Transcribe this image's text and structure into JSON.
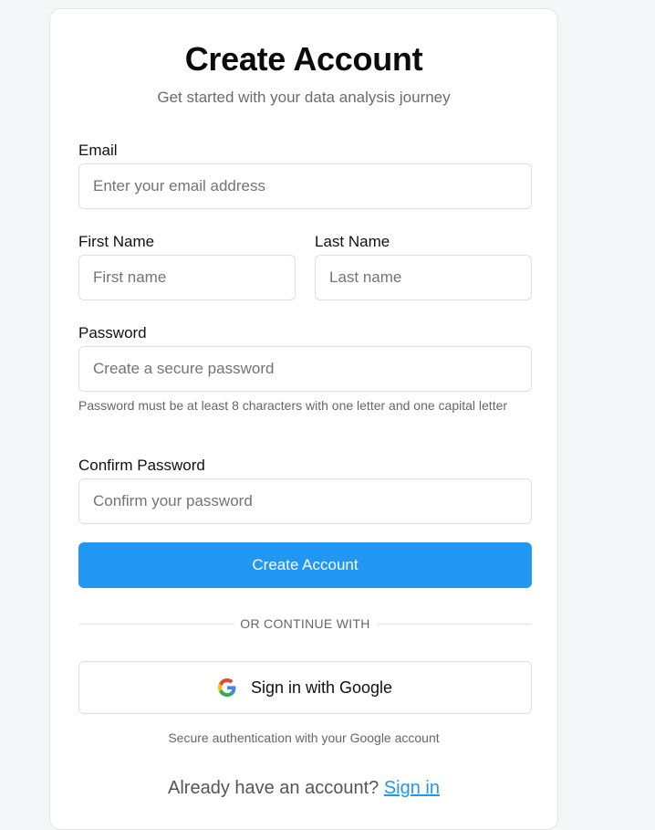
{
  "header": {
    "title": "Create Account",
    "subtitle": "Get started with your data analysis journey"
  },
  "form": {
    "email": {
      "label": "Email",
      "placeholder": "Enter your email address",
      "value": ""
    },
    "first_name": {
      "label": "First Name",
      "placeholder": "First name",
      "value": ""
    },
    "last_name": {
      "label": "Last Name",
      "placeholder": "Last name",
      "value": ""
    },
    "password": {
      "label": "Password",
      "placeholder": "Create a secure password",
      "value": "",
      "hint": "Password must be at least 8 characters with one letter and one capital letter"
    },
    "confirm_password": {
      "label": "Confirm Password",
      "placeholder": "Confirm your password",
      "value": ""
    },
    "submit_label": "Create Account"
  },
  "divider": {
    "text": "OR CONTINUE WITH"
  },
  "google": {
    "button_label": "Sign in with Google",
    "icon": "google-icon",
    "note": "Secure authentication with your Google account"
  },
  "footer": {
    "prompt": "Already have an account?",
    "link_label": "Sign in"
  },
  "colors": {
    "primary": "#2196f3",
    "background": "#f5f6f7",
    "card": "#ffffff",
    "border": "#dcdfe3"
  }
}
